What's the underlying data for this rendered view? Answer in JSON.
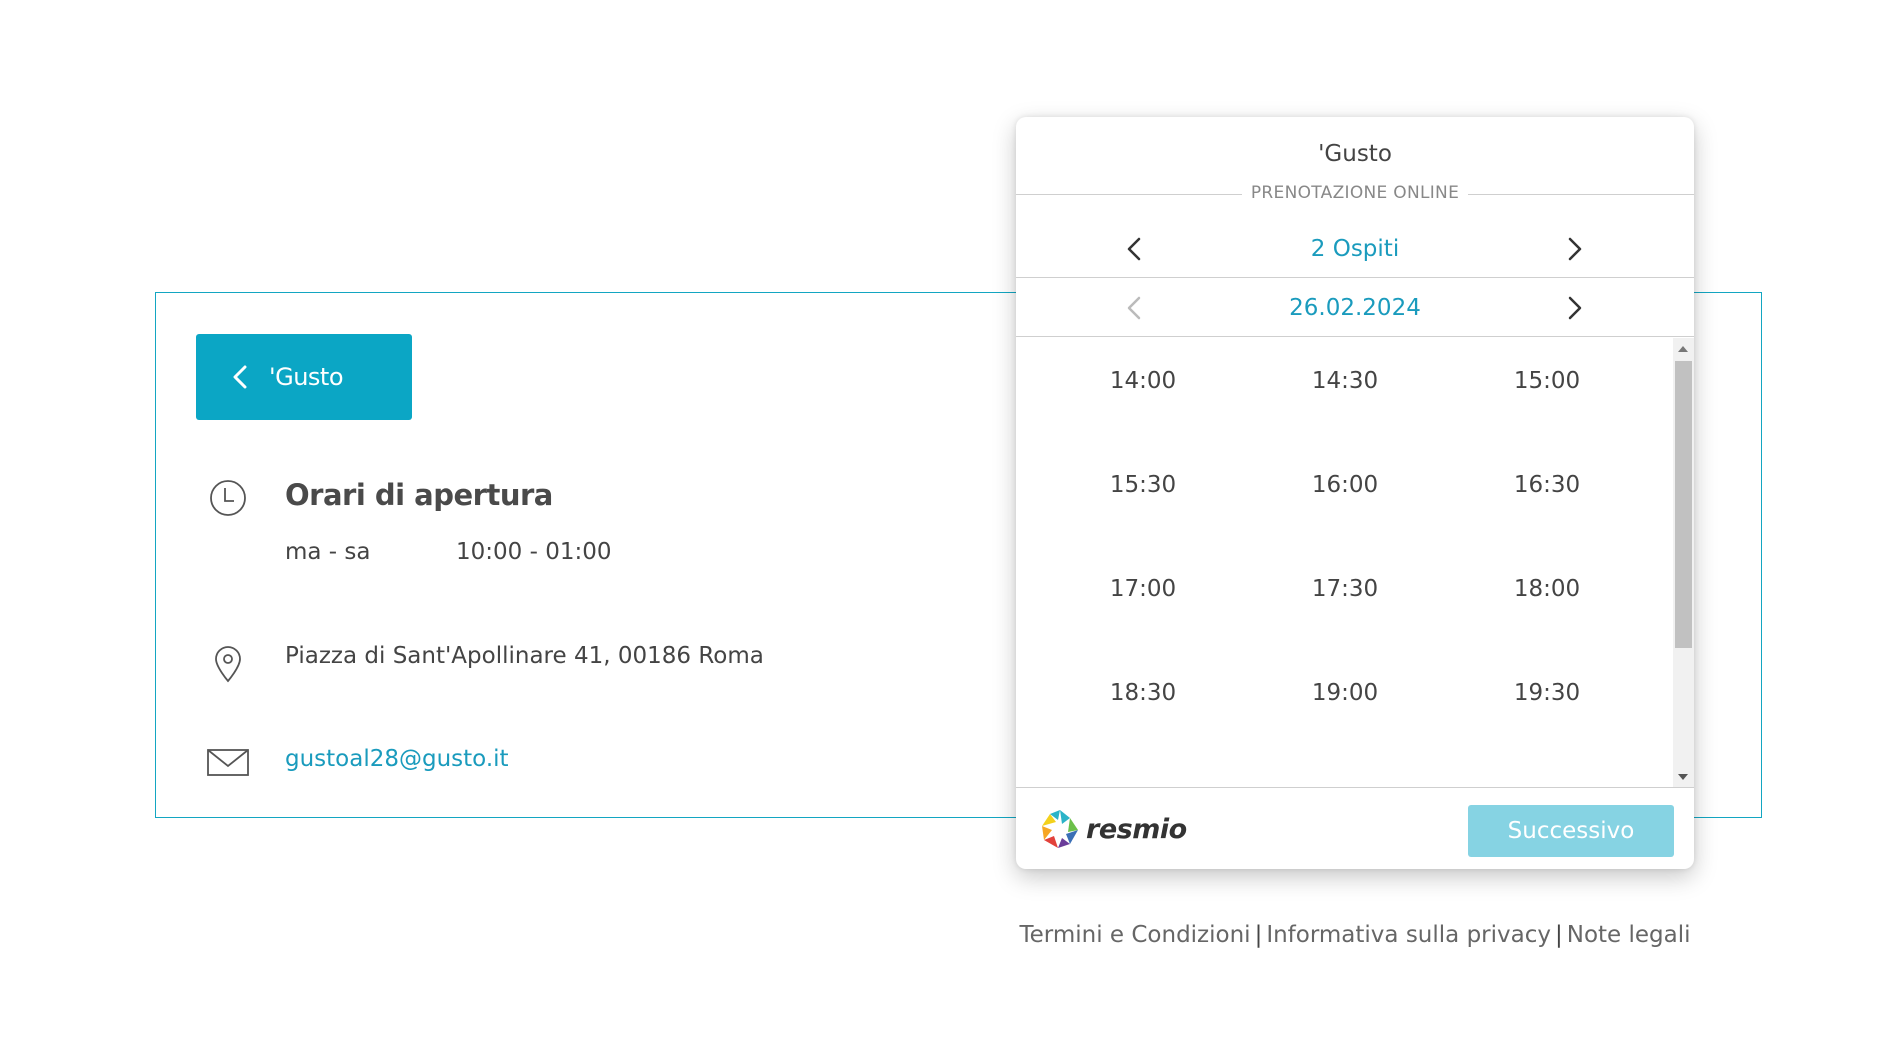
{
  "info_card": {
    "back_button_label": "'Gusto",
    "hours_title": "Orari di apertura",
    "hours_days": "ma - sa",
    "hours_time": "10:00 - 01:00",
    "address": "Piazza di Sant'Apollinare 41, 00186 Roma",
    "email": "gustoal28@gusto.it",
    "icons": [
      "clock-icon",
      "location-pin-icon",
      "mail-icon"
    ]
  },
  "widget": {
    "title": "'Gusto",
    "subtitle": "PRENOTAZIONE ONLINE",
    "guests": "2 Ospiti",
    "date": "26.02.2024",
    "time_slots": [
      "14:00",
      "14:30",
      "15:00",
      "15:30",
      "16:00",
      "16:30",
      "17:00",
      "17:30",
      "18:00",
      "18:30",
      "19:00",
      "19:30"
    ],
    "brand": "resmio",
    "next_label": "Successivo",
    "colors": {
      "accent": "#0ba6c5",
      "link": "#1a9bbd",
      "button_disabled": "#86d3e3"
    }
  },
  "legal": {
    "terms": "Termini e Condizioni",
    "privacy": "Informativa sulla privacy",
    "notes": "Note legali",
    "separator": "|"
  }
}
